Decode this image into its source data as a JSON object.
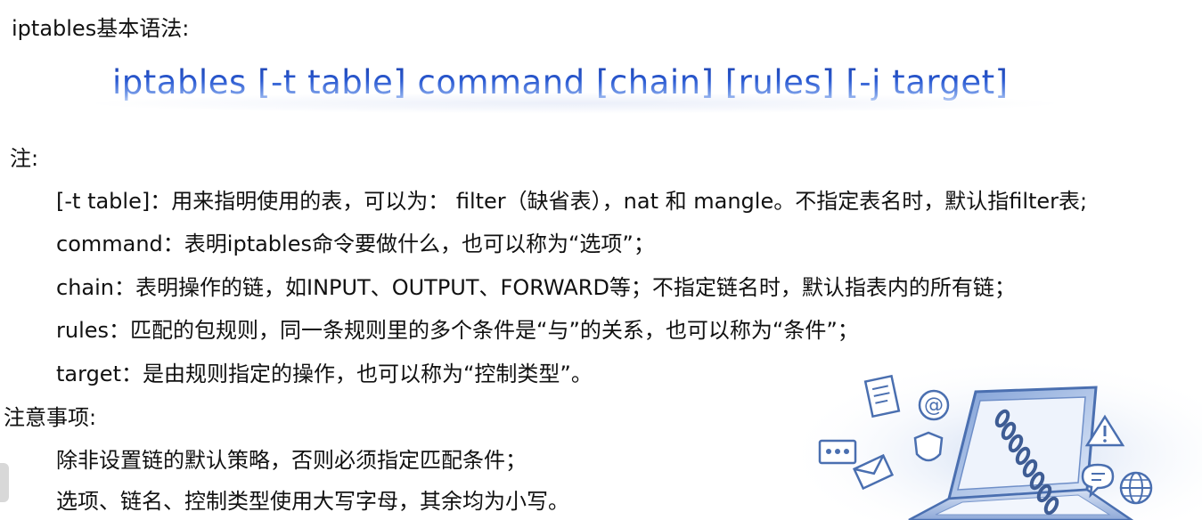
{
  "heading": "iptables基本语法:",
  "syntax": "iptables [-t table] command [chain] [rules] [-j target]",
  "notes": {
    "label": "注:",
    "items": [
      "[-t table]：用来指明使用的表，可以为： filter（缺省表），nat 和 mangle。不指定表名时，默认指filter表;",
      "command：表明iptables命令要做什么，也可以称为“选项”；",
      "chain：表明操作的链，如INPUT、OUTPUT、FORWARD等；不指定链名时，默认指表内的所有链；",
      "rules：匹配的包规则，同一条规则里的多个条件是“与”的关系，也可以称为“条件”；",
      "target：是由规则指定的操作，也可以称为“控制类型”。"
    ]
  },
  "cautions": {
    "label": "注意事项:",
    "items": [
      "除非设置链的默认策略，否则必须指定匹配条件；",
      "选项、链名、控制类型使用大写字母，其余均为小写。"
    ]
  },
  "colors": {
    "text": "#111111",
    "syntax_dark": "#1c3fa8",
    "syntax_light": "#7fa2ea",
    "illustration": "#4a6fb0"
  },
  "illustration": {
    "icons": [
      "document-icon",
      "at-sign-icon",
      "warning-icon",
      "shield-icon",
      "envelope-icon",
      "network-icon",
      "chat-icon",
      "globe-icon",
      "laptop-icon",
      "chain-icon"
    ]
  }
}
